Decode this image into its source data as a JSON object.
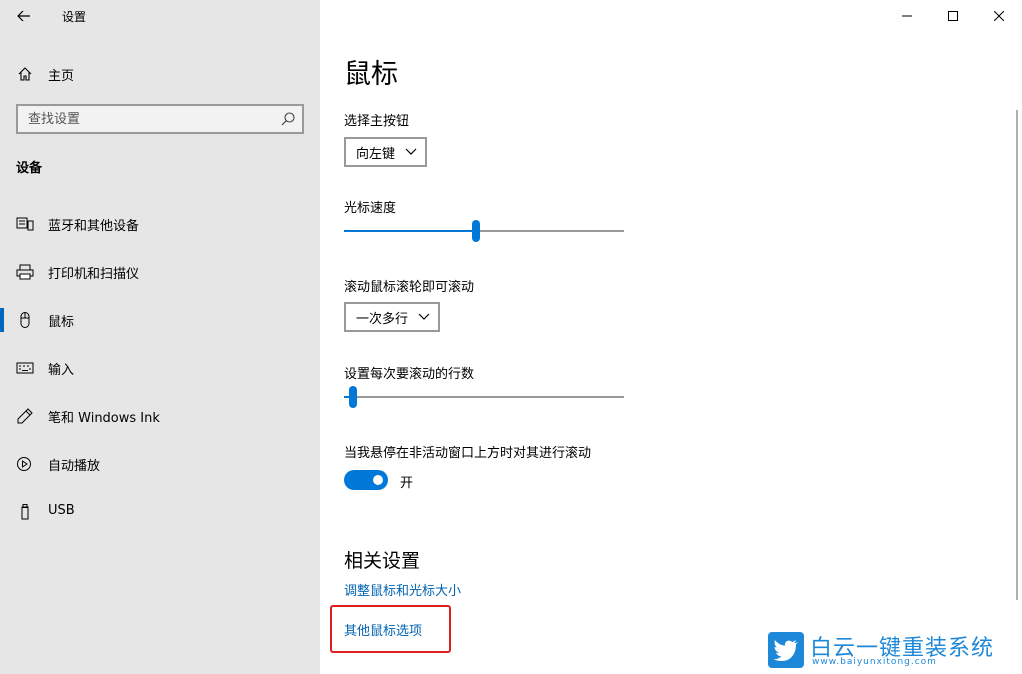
{
  "window": {
    "title": "设置"
  },
  "sidebar": {
    "home_label": "主页",
    "search_placeholder": "查找设置",
    "section_title": "设备",
    "items": [
      {
        "label": "蓝牙和其他设备",
        "icon": "bluetooth-devices-icon"
      },
      {
        "label": "打印机和扫描仪",
        "icon": "printer-icon"
      },
      {
        "label": "鼠标",
        "icon": "mouse-icon",
        "selected": true
      },
      {
        "label": "输入",
        "icon": "keyboard-icon"
      },
      {
        "label": "笔和 Windows Ink",
        "icon": "pen-icon"
      },
      {
        "label": "自动播放",
        "icon": "autoplay-icon"
      },
      {
        "label": "USB",
        "icon": "usb-icon"
      }
    ]
  },
  "main": {
    "title": "鼠标",
    "primary_button": {
      "label": "选择主按钮",
      "value": "向左键"
    },
    "cursor_speed": {
      "label": "光标速度",
      "value_fraction": 0.47
    },
    "scroll_wheel": {
      "label": "滚动鼠标滚轮即可滚动",
      "value": "一次多行"
    },
    "scroll_lines": {
      "label": "设置每次要滚动的行数",
      "value_fraction": 0.02
    },
    "inactive_scroll": {
      "label": "当我悬停在非活动窗口上方时对其进行滚动",
      "state_label": "开",
      "on": true
    },
    "related": {
      "title": "相关设置",
      "links": [
        "调整鼠标和光标大小",
        "其他鼠标选项"
      ]
    }
  },
  "watermark": {
    "brand": "白云一键重装系统",
    "url": "www.baiyunxitong.com"
  },
  "colors": {
    "accent": "#0078d7",
    "link": "#0063b1",
    "sidebar_bg": "#e6e6e6",
    "highlight": "#e02020"
  }
}
